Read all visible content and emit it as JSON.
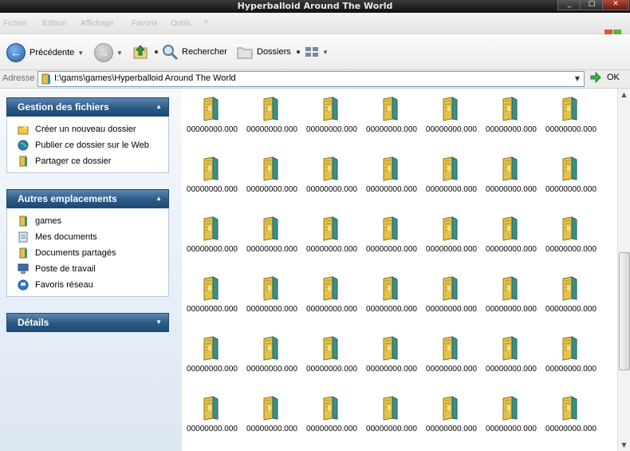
{
  "window": {
    "title": "Hyperballoid Around The World"
  },
  "menu": {
    "items": [
      "Fichier",
      "Edition",
      "Affichage",
      "Favoris",
      "Outils",
      "?"
    ]
  },
  "toolbar": {
    "back_label": "Précédente",
    "search_label": "Rechercher",
    "folders_label": "Dossiers"
  },
  "address": {
    "label": "Adresse",
    "path": "I:\\gams\\games\\Hyperballoid Around The World",
    "go_label": "OK"
  },
  "left_pane": {
    "file_tasks": {
      "title": "Gestion des fichiers",
      "items": [
        {
          "label": "Créer un nouveau dossier",
          "icon": "new-folder-icon"
        },
        {
          "label": "Publier ce dossier sur le Web",
          "icon": "publish-web-icon"
        },
        {
          "label": "Partager ce dossier",
          "icon": "share-folder-icon"
        }
      ]
    },
    "other_places": {
      "title": "Autres emplacements",
      "items": [
        {
          "label": "games",
          "icon": "folder-icon"
        },
        {
          "label": "Mes documents",
          "icon": "my-documents-icon"
        },
        {
          "label": "Documents partagés",
          "icon": "shared-documents-icon"
        },
        {
          "label": "Poste de travail",
          "icon": "my-computer-icon"
        },
        {
          "label": "Favoris réseau",
          "icon": "network-places-icon"
        }
      ]
    },
    "details": {
      "title": "Détails"
    }
  },
  "files": {
    "name": "00000000.000",
    "columns": 7,
    "rows": 6,
    "icon": "file-archive-icon"
  },
  "colors": {
    "panel_header": "#2c5a86",
    "title_bar": "#1a1a1a",
    "file_icon_yellow": "#e3c24a",
    "file_icon_teal": "#3c8f8a"
  }
}
